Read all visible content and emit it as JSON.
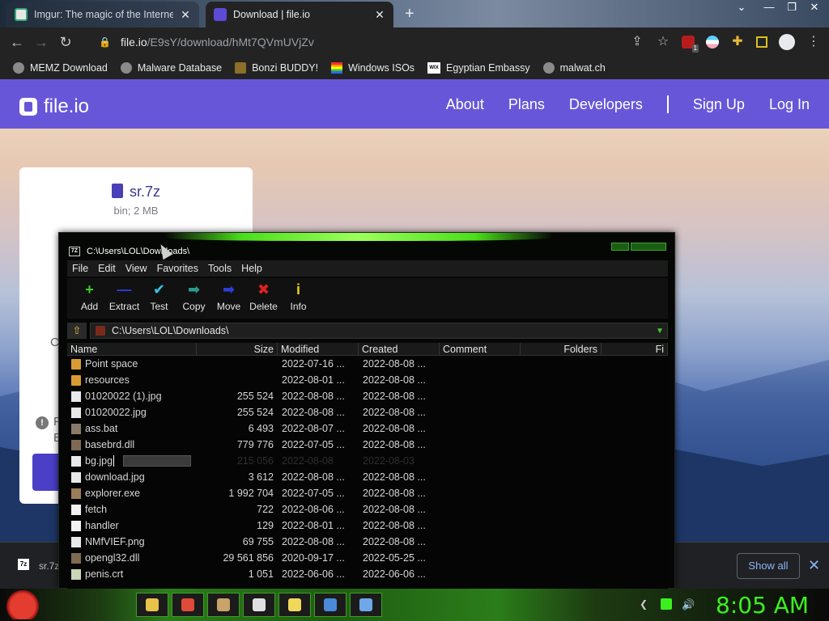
{
  "browser": {
    "tabs": [
      {
        "title": "Imgur: The magic of the Internet",
        "active": false
      },
      {
        "title": "Download | file.io",
        "active": true
      }
    ],
    "url": {
      "host": "file.io",
      "path": "/E9sY/download/hMt7QVmUVjZv"
    },
    "extension_badge": "1",
    "bookmarks": [
      {
        "label": "MEMZ Download",
        "icon": "globe-icon"
      },
      {
        "label": "Malware Database",
        "icon": "globe-icon"
      },
      {
        "label": "Bonzi BUDDY!",
        "icon": "monkey-icon"
      },
      {
        "label": "Windows ISOs",
        "icon": "rainbow-icon"
      },
      {
        "label": "Egyptian Embassy",
        "icon": "wix-icon"
      },
      {
        "label": "malwat.ch",
        "icon": "globe-icon"
      }
    ]
  },
  "fileio": {
    "logo": "file.io",
    "nav": [
      "About",
      "Plans",
      "Developers",
      "Sign Up",
      "Log In"
    ],
    "file_name": "sr.7z",
    "file_meta": "bin; 2 MB",
    "frag_c": "C",
    "frag_f": "F",
    "frag_e": "E",
    "accent": "#6757d8"
  },
  "download_shelf": {
    "item": "sr.7z",
    "show_all": "Show all"
  },
  "sevenzip": {
    "title": "C:\\Users\\LOL\\Downloads\\",
    "menu": [
      "File",
      "Edit",
      "View",
      "Favorites",
      "Tools",
      "Help"
    ],
    "toolbar": [
      {
        "label": "Add",
        "icon": "plus-icon",
        "color": "#3cd02a",
        "glyph": "+"
      },
      {
        "label": "Extract",
        "icon": "minus-icon",
        "color": "#2d3fd6",
        "glyph": "—"
      },
      {
        "label": "Test",
        "icon": "check-icon",
        "color": "#2fc7e8",
        "glyph": "✔"
      },
      {
        "label": "Copy",
        "icon": "copy-arrow-icon",
        "color": "#2a9a8a",
        "glyph": "➡"
      },
      {
        "label": "Move",
        "icon": "move-arrow-icon",
        "color": "#2d3fd6",
        "glyph": "➡"
      },
      {
        "label": "Delete",
        "icon": "delete-x-icon",
        "color": "#e02020",
        "glyph": "✖"
      },
      {
        "label": "Info",
        "icon": "info-icon",
        "color": "#e8d020",
        "glyph": "i"
      }
    ],
    "address": "C:\\Users\\LOL\\Downloads\\",
    "columns": [
      "Name",
      "Size",
      "Modified",
      "Created",
      "Comment",
      "Folders",
      "Fi"
    ],
    "rows": [
      {
        "name": "Point space",
        "size": "",
        "modified": "2022-07-16 ...",
        "created": "2022-08-08 ...",
        "type": "folder"
      },
      {
        "name": "resources",
        "size": "",
        "modified": "2022-08-01 ...",
        "created": "2022-08-08 ...",
        "type": "folder"
      },
      {
        "name": "01020022 (1).jpg",
        "size": "255 524",
        "modified": "2022-08-08 ...",
        "created": "2022-08-08 ...",
        "type": "img"
      },
      {
        "name": "01020022.jpg",
        "size": "255 524",
        "modified": "2022-08-08 ...",
        "created": "2022-08-08 ...",
        "type": "img"
      },
      {
        "name": "ass.bat",
        "size": "6 493",
        "modified": "2022-08-07 ...",
        "created": "2022-08-08 ...",
        "type": "bat"
      },
      {
        "name": "basebrd.dll",
        "size": "779 776",
        "modified": "2022-07-05 ...",
        "created": "2022-08-08 ...",
        "type": "dll"
      },
      {
        "name": "bg.jpg",
        "size": "215 056",
        "modified": "2022-08-08",
        "created": "2022-08-03",
        "type": "img",
        "renaming": true
      },
      {
        "name": "download.jpg",
        "size": "3 612",
        "modified": "2022-08-08 ...",
        "created": "2022-08-08 ...",
        "type": "img"
      },
      {
        "name": "explorer.exe",
        "size": "1 992 704",
        "modified": "2022-07-05 ...",
        "created": "2022-08-08 ...",
        "type": "exe"
      },
      {
        "name": "fetch",
        "size": "722",
        "modified": "2022-08-06 ...",
        "created": "2022-08-08 ...",
        "type": "plain"
      },
      {
        "name": "handler",
        "size": "129",
        "modified": "2022-08-01 ...",
        "created": "2022-08-08 ...",
        "type": "plain"
      },
      {
        "name": "NMfVIEF.png",
        "size": "69 755",
        "modified": "2022-08-08 ...",
        "created": "2022-08-08 ...",
        "type": "img"
      },
      {
        "name": "opengl32.dll",
        "size": "29 561 856",
        "modified": "2020-09-17 ...",
        "created": "2022-05-25 ...",
        "type": "dll"
      },
      {
        "name": "penis.crt",
        "size": "1 051",
        "modified": "2022-06-06 ...",
        "created": "2022-06-06 ...",
        "type": "crt"
      }
    ]
  },
  "taskbar": {
    "clock": "8:05 AM",
    "pinned": [
      "folder-icon",
      "chrome-icon",
      "paint-icon",
      "7zip-icon",
      "notepad-icon",
      "window-icon",
      "remote-icon"
    ],
    "accent": "#3cf020"
  }
}
